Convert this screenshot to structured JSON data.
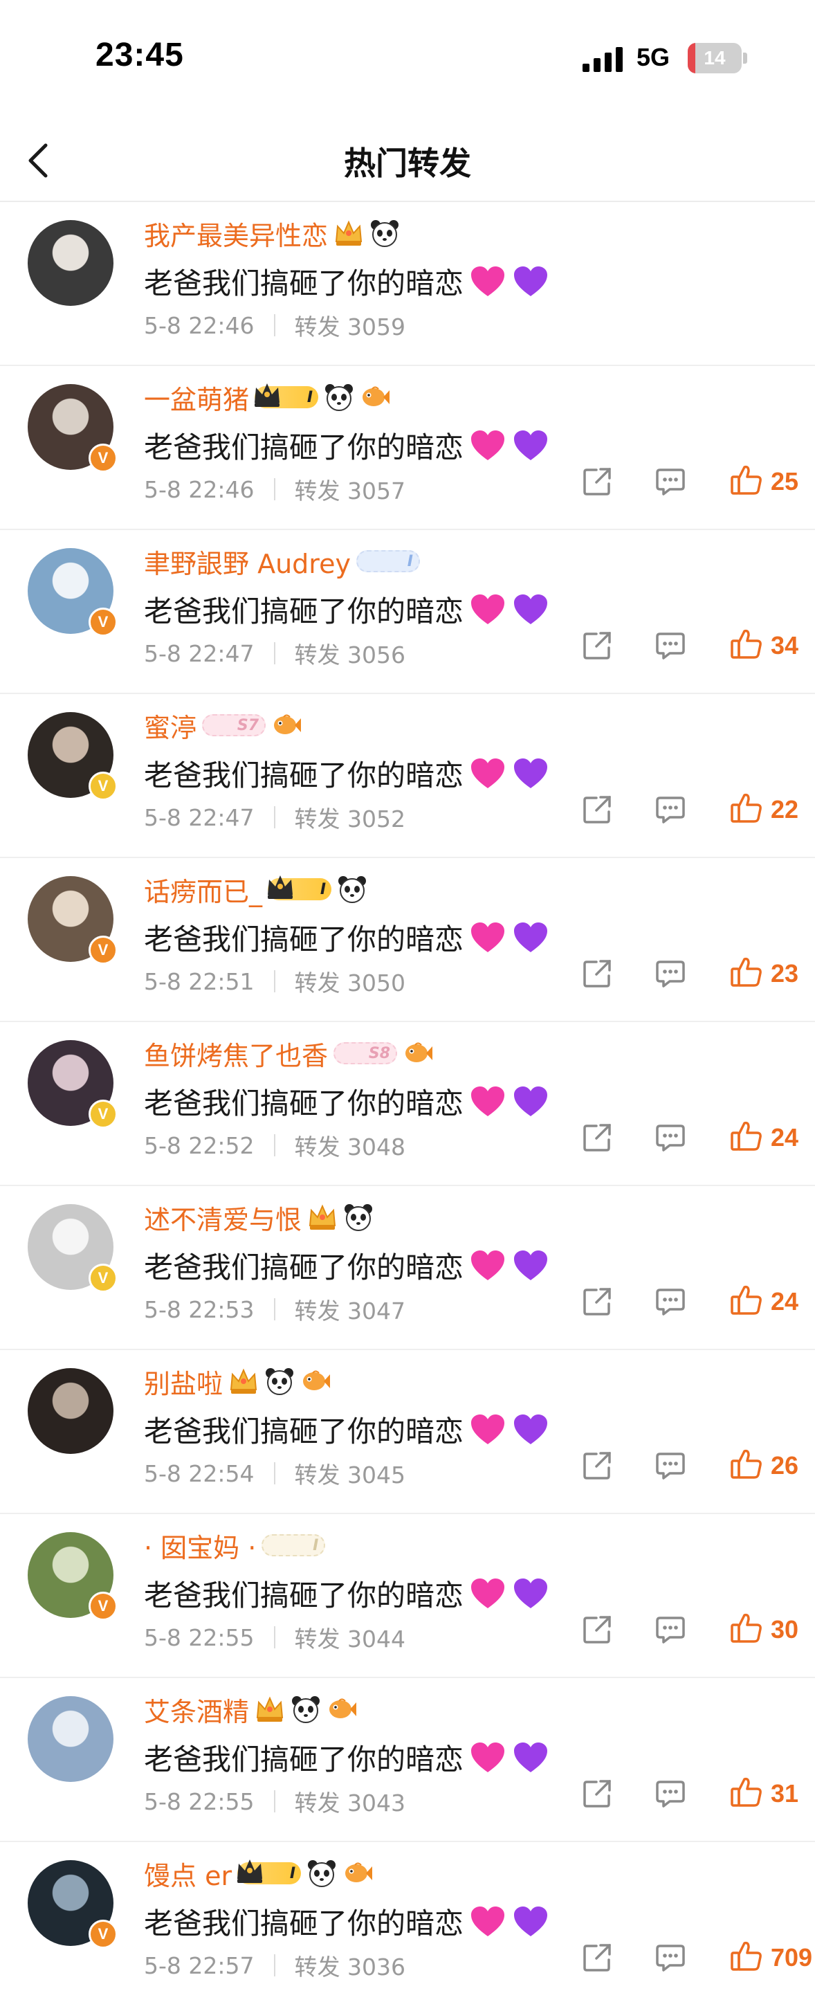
{
  "status": {
    "time": "23:45",
    "network": "5G",
    "battery": "14",
    "battery_pct": 14
  },
  "nav": {
    "title": "热门转发"
  },
  "colors": {
    "accent": "#ec6c1f",
    "verified_orange": "#f08a24",
    "verified_gold": "#f2c230",
    "heart_pink": "#f23aa8",
    "heart_purple": "#9b3ee8"
  },
  "icons": {
    "back": "chevron-left-icon",
    "share": "share-icon",
    "comment": "comment-icon",
    "like": "thumbs-up-icon",
    "heart_pink": "pink-heart-emoji",
    "heart_purple": "purple-heart-emoji"
  },
  "items": [
    {
      "name": "我产最美异性恋",
      "badges": [
        "crown-gold",
        "panda"
      ],
      "text": "老爸我们搞砸了你的暗恋",
      "date": "5-8 22:46",
      "repost": "转发 3059",
      "likes": "",
      "verified": "",
      "avatar": [
        "#3a3a3a",
        "#e7e2dc"
      ]
    },
    {
      "name": "一盆萌猪",
      "badges": [
        "crown-pill",
        "panda",
        "fish"
      ],
      "pill": "I",
      "pill_style": "gold",
      "text": "老爸我们搞砸了你的暗恋",
      "date": "5-8 22:46",
      "repost": "转发 3057",
      "likes": "25",
      "verified": "V",
      "verified_color": "orange",
      "avatar": [
        "#4a3a34",
        "#d8cfc6"
      ]
    },
    {
      "name": "聿野詪野 Audrey",
      "badges": [
        "level-pill"
      ],
      "pill": "I",
      "pill_style": "blue",
      "text": "老爸我们搞砸了你的暗恋",
      "date": "5-8 22:47",
      "repost": "转发 3056",
      "likes": "34",
      "verified": "V",
      "verified_color": "orange",
      "avatar": [
        "#7fa6c9",
        "#eef3f8"
      ]
    },
    {
      "name": "蜜渟",
      "badges": [
        "level-pill",
        "fish"
      ],
      "pill": "S7",
      "pill_style": "pink",
      "text": "老爸我们搞砸了你的暗恋",
      "date": "5-8 22:47",
      "repost": "转发 3052",
      "likes": "22",
      "verified": "V",
      "verified_color": "gold",
      "avatar": [
        "#2e2824",
        "#c9b7a8"
      ]
    },
    {
      "name": "话痨而已_",
      "badges": [
        "crown-pill",
        "panda"
      ],
      "pill": "I",
      "pill_style": "gold",
      "text": "老爸我们搞砸了你的暗恋",
      "date": "5-8 22:51",
      "repost": "转发 3050",
      "likes": "23",
      "verified": "V",
      "verified_color": "orange",
      "avatar": [
        "#6b5848",
        "#e6d8c8"
      ]
    },
    {
      "name": "鱼饼烤焦了也香",
      "badges": [
        "level-pill",
        "fish"
      ],
      "pill": "S8",
      "pill_style": "pink",
      "text": "老爸我们搞砸了你的暗恋",
      "date": "5-8 22:52",
      "repost": "转发 3048",
      "likes": "24",
      "verified": "V",
      "verified_color": "gold",
      "avatar": [
        "#3b2f3a",
        "#d9c4cc"
      ]
    },
    {
      "name": "述不清爱与恨",
      "badges": [
        "crown-gold",
        "panda"
      ],
      "text": "老爸我们搞砸了你的暗恋",
      "date": "5-8 22:53",
      "repost": "转发 3047",
      "likes": "24",
      "verified": "V",
      "verified_color": "gold",
      "avatar": [
        "#c9c9c9",
        "#f5f5f5"
      ]
    },
    {
      "name": "别盐啦",
      "badges": [
        "crown-gold",
        "panda",
        "fish"
      ],
      "text": "老爸我们搞砸了你的暗恋",
      "date": "5-8 22:54",
      "repost": "转发 3045",
      "likes": "26",
      "verified": "",
      "avatar": [
        "#2a2320",
        "#b8a89a"
      ]
    },
    {
      "name": "· 囡宝妈 ·",
      "badges": [
        "level-pill"
      ],
      "pill": "I",
      "pill_style": "cream",
      "text": "老爸我们搞砸了你的暗恋",
      "date": "5-8 22:55",
      "repost": "转发 3044",
      "likes": "30",
      "verified": "V",
      "verified_color": "orange",
      "avatar": [
        "#6e8a4a",
        "#d7e0c2"
      ]
    },
    {
      "name": "艾条酒精",
      "badges": [
        "crown-gold",
        "panda",
        "fish"
      ],
      "text": "老爸我们搞砸了你的暗恋",
      "date": "5-8 22:55",
      "repost": "转发 3043",
      "likes": "31",
      "verified": "",
      "avatar": [
        "#8fa9c7",
        "#e7edf4"
      ]
    },
    {
      "name": "馒点 er",
      "badges": [
        "crown-pill",
        "panda",
        "fish"
      ],
      "pill": "I",
      "pill_style": "gold",
      "text": "老爸我们搞砸了你的暗恋",
      "date": "5-8 22:57",
      "repost": "转发 3036",
      "likes": "709",
      "verified": "V",
      "verified_color": "orange",
      "avatar": [
        "#1f2a33",
        "#8ea3b5"
      ]
    }
  ]
}
